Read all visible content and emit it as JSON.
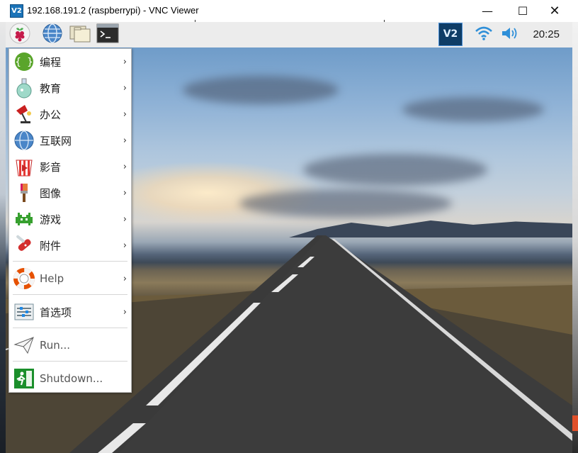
{
  "window": {
    "title": "192.168.191.2 (raspberrypi) - VNC Viewer",
    "app_icon_text": "V2",
    "minimize_glyph": "—",
    "maximize_glyph": "☐",
    "close_glyph": "✕"
  },
  "panel": {
    "buttons": [
      {
        "name": "raspberry-menu-button",
        "icon": "raspberry-icon"
      },
      {
        "name": "web-browser-button",
        "icon": "globe-icon"
      },
      {
        "name": "file-manager-button",
        "icon": "folders-icon"
      },
      {
        "name": "terminal-button",
        "icon": "terminal-icon"
      }
    ],
    "tray": {
      "vnc_text": "V2",
      "wifi_icon": "wifi-icon",
      "volume_icon": "speaker-icon",
      "clock": "20:25"
    }
  },
  "menu": {
    "items": [
      {
        "label": "编程",
        "icon": "programming-braces-icon",
        "submenu": true
      },
      {
        "label": "教育",
        "icon": "education-flask-icon",
        "submenu": true
      },
      {
        "label": "办公",
        "icon": "office-lamp-icon",
        "submenu": true
      },
      {
        "label": "互联网",
        "icon": "internet-globe-icon",
        "submenu": true
      },
      {
        "label": "影音",
        "icon": "media-popcorn-icon",
        "submenu": true
      },
      {
        "label": "图像",
        "icon": "graphics-brush-icon",
        "submenu": true
      },
      {
        "label": "游戏",
        "icon": "games-invader-icon",
        "submenu": true
      },
      {
        "label": "附件",
        "icon": "accessories-knife-icon",
        "submenu": true
      },
      {
        "label": "Help",
        "icon": "help-lifebuoy-icon",
        "submenu": true
      },
      {
        "label": "首选项",
        "icon": "preferences-sliders-icon",
        "submenu": true
      },
      {
        "label": "Run...",
        "icon": "run-paperplane-icon",
        "submenu": false
      },
      {
        "label": "Shutdown...",
        "icon": "shutdown-exit-icon",
        "submenu": false
      }
    ],
    "arrow": "›"
  },
  "colors": {
    "accent": "#1a73b8",
    "menu_bg": "#ffffff",
    "panel_bg": "#ececec"
  }
}
